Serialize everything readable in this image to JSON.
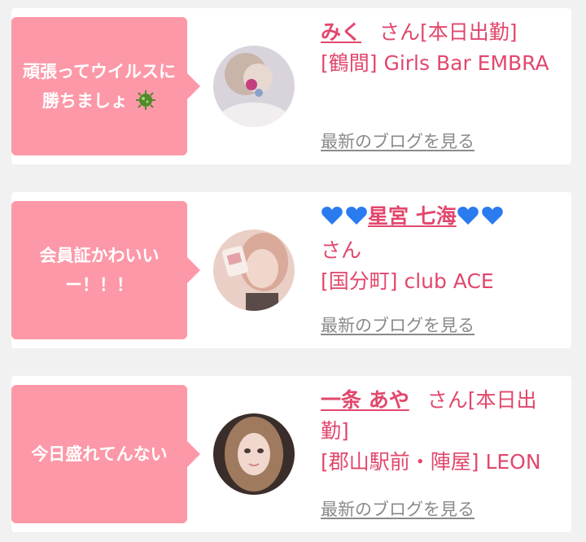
{
  "cards": [
    {
      "message": "頑張ってウイルスに勝ちましょ",
      "message_icon": "virus-icon",
      "name": "みく",
      "suffix": "さん[本日出勤]",
      "shop": "[鶴間] Girls Bar EMBRA",
      "blog_link": "最新のブログを見る"
    },
    {
      "message": "会員証かわいいー！！！",
      "name_hearts_before": "blue-heart-icon x2",
      "name": "星宮 七海",
      "name_hearts_after": "blue-heart-icon x2",
      "suffix": "さん",
      "shop": "[国分町] club ACE",
      "blog_link": "最新のブログを見る"
    },
    {
      "message": "今日盛れてんない",
      "name": "一条 あや",
      "suffix": "さん[本日出勤]",
      "shop": "[郡山駅前・陣屋] LEON",
      "blog_link": "最新のブログを見る"
    }
  ],
  "colors": {
    "page_bg": "#f1f1f1",
    "card_bg": "#ffffff",
    "bubble_bg": "#fd98a8",
    "accent_pink": "#e2476c",
    "link_gray": "#8a8a8a",
    "heart_blue": "#2a7bf0"
  }
}
